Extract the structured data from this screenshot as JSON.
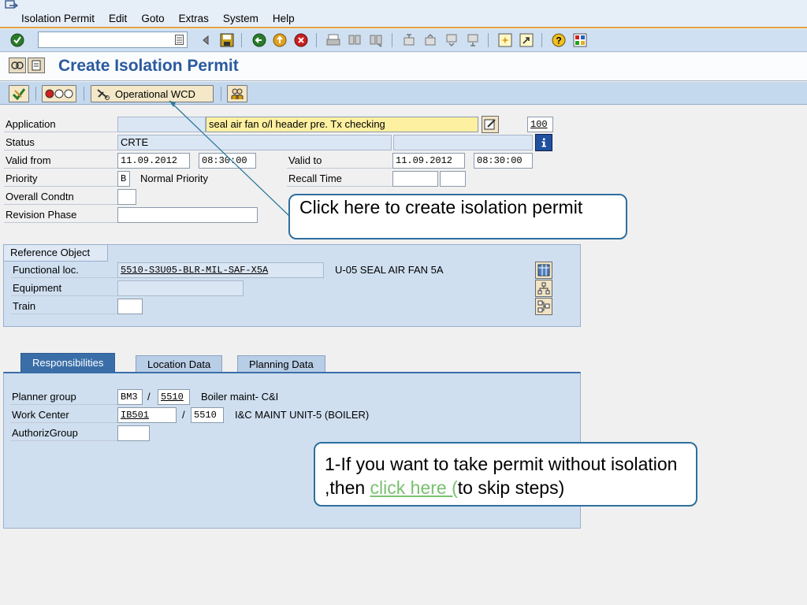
{
  "menu": {
    "items": [
      "Isolation Permit",
      "Edit",
      "Goto",
      "Extras",
      "System",
      "Help"
    ]
  },
  "command_field": {
    "value": "",
    "placeholder": ""
  },
  "title": "Create Isolation Permit",
  "app_toolbar": {
    "operational_wcd_label": "Operational WCD"
  },
  "form": {
    "application_label": "Application",
    "application_value": "",
    "application_text": "seal air fan o/l header pre. Tx checking",
    "application_number": "100",
    "status_label": "Status",
    "status_value": "CRTE",
    "status_value2": "",
    "valid_from_label": "Valid from",
    "valid_from_date": "11.09.2012",
    "valid_from_time": "08:30:00",
    "valid_to_label": "Valid to",
    "valid_to_date": "11.09.2012",
    "valid_to_time": "08:30:00",
    "priority_label": "Priority",
    "priority_value": "B",
    "priority_text": "Normal Priority",
    "recall_time_label": "Recall Time",
    "recall_time_value1": "",
    "recall_time_value2": "",
    "overall_condtn_label": "Overall Condtn",
    "overall_condtn_value": "",
    "revision_phase_label": "Revision Phase",
    "revision_phase_value": ""
  },
  "reference_object": {
    "title": "Reference Object",
    "functional_loc_label": "Functional loc.",
    "functional_loc_value": "5510-S3U05-BLR-MIL-SAF-X5A",
    "functional_loc_text": "U-05 SEAL AIR FAN 5A",
    "equipment_label": "Equipment",
    "equipment_value": "",
    "train_label": "Train",
    "train_value": ""
  },
  "tabs": [
    "Responsibilities",
    "Location Data",
    "Planning Data"
  ],
  "responsibilities": {
    "planner_group_label": "Planner group",
    "planner_group_value": "BM3",
    "planner_group_sep": "/",
    "planner_group_plant": "5510",
    "planner_group_text": "Boiler maint- C&I",
    "work_center_label": "Work Center",
    "work_center_value": "IB501",
    "work_center_sep": "/",
    "work_center_plant": "5510",
    "work_center_text": "I&C MAINT UNIT-5 (BOILER)",
    "authoriz_group_label": "AuthorizGroup",
    "authoriz_group_value": ""
  },
  "callouts": {
    "create_permit": " Click here to create isolation permit",
    "skip_prefix": "1-If you want to take permit without isolation ,then ",
    "skip_link": "click here (",
    "skip_suffix": "to skip steps)"
  }
}
